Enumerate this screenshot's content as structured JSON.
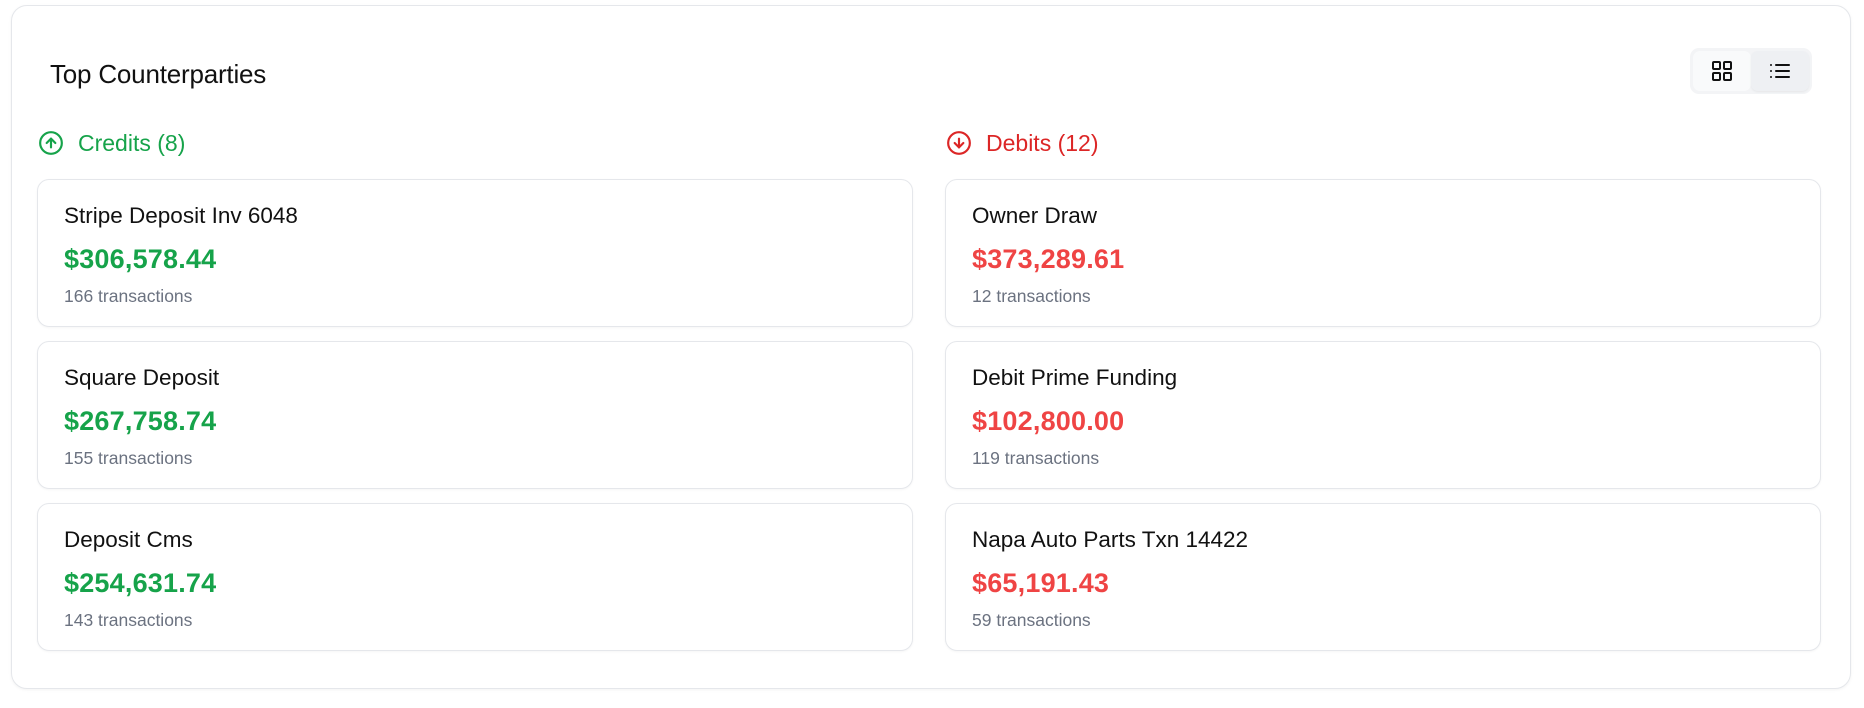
{
  "panel": {
    "title": "Top Counterparties"
  },
  "view_toggle": {
    "options": [
      {
        "icon": "grid-icon",
        "selected": false
      },
      {
        "icon": "list-icon",
        "selected": true
      }
    ]
  },
  "colors": {
    "credit": "#16a34a",
    "debit": "#ef4444",
    "muted": "#6b7280",
    "border": "#e5e7eb"
  },
  "credits": {
    "header": "Credits (8)",
    "icon": "arrow-up-circle-icon",
    "items": [
      {
        "name": "Stripe Deposit Inv 6048",
        "amount": "$306,578.44",
        "count": "166 transactions"
      },
      {
        "name": "Square Deposit",
        "amount": "$267,758.74",
        "count": "155 transactions"
      },
      {
        "name": "Deposit Cms",
        "amount": "$254,631.74",
        "count": "143 transactions"
      }
    ]
  },
  "debits": {
    "header": "Debits (12)",
    "icon": "arrow-down-circle-icon",
    "items": [
      {
        "name": "Owner Draw",
        "amount": "$373,289.61",
        "count": "12 transactions"
      },
      {
        "name": "Debit Prime Funding",
        "amount": "$102,800.00",
        "count": "119 transactions"
      },
      {
        "name": "Napa Auto Parts Txn 14422",
        "amount": "$65,191.43",
        "count": "59 transactions"
      }
    ]
  }
}
